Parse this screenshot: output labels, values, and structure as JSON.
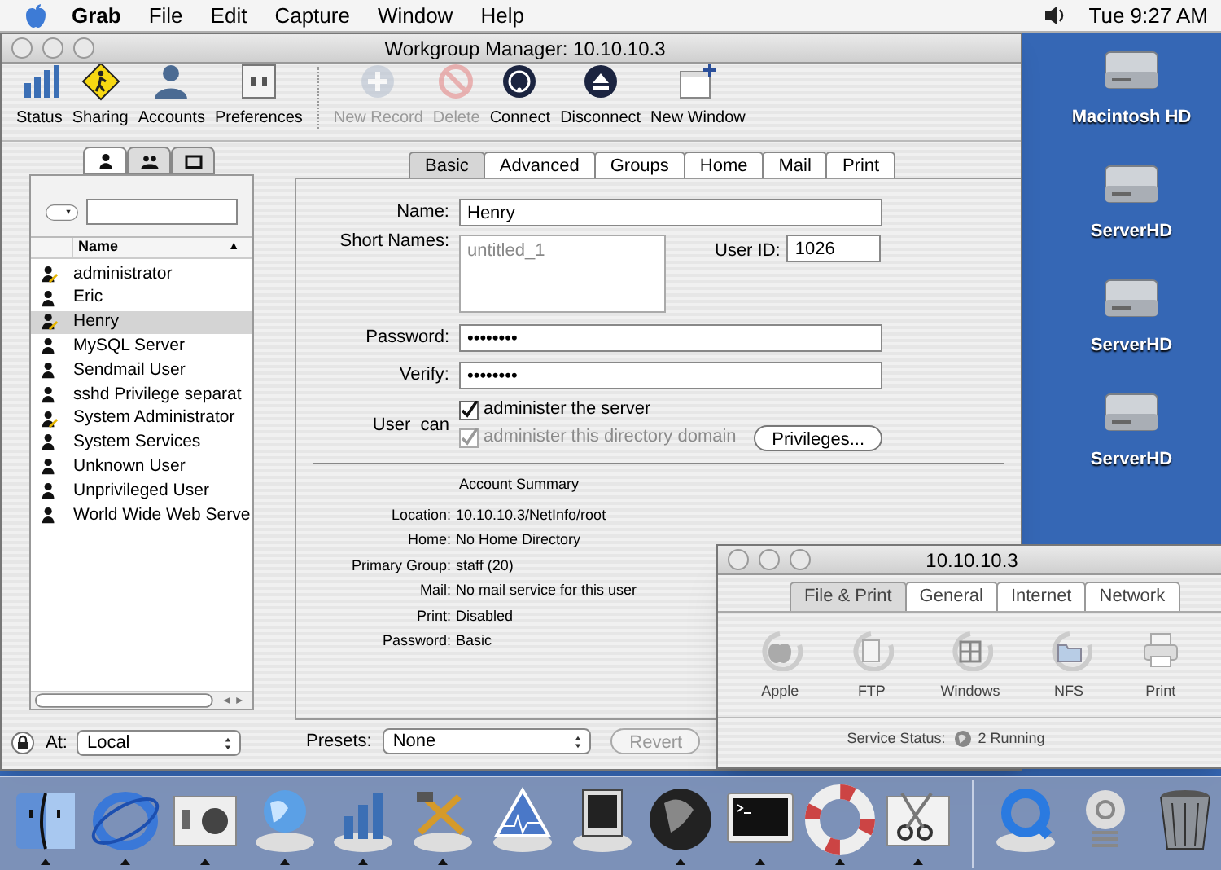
{
  "menu_bar": {
    "app": "Grab",
    "menus": [
      "File",
      "Edit",
      "Capture",
      "Window",
      "Help"
    ],
    "clock": "Tue 9:27 AM"
  },
  "desktop": {
    "volumes": [
      "Macintosh HD",
      "ServerHD",
      "ServerHD",
      "ServerHD"
    ]
  },
  "window": {
    "title": "Workgroup Manager: 10.10.10.3",
    "toolbar_groups": [
      {
        "items": [
          {
            "label": "Status",
            "disabled": false
          },
          {
            "label": "Sharing",
            "disabled": false
          },
          {
            "label": "Accounts",
            "disabled": false
          },
          {
            "label": "Preferences",
            "disabled": false
          }
        ]
      },
      {
        "items": [
          {
            "label": "New Record",
            "disabled": true
          },
          {
            "label": "Delete",
            "disabled": true
          },
          {
            "label": "Connect",
            "disabled": false
          },
          {
            "label": "Disconnect",
            "disabled": false
          },
          {
            "label": "New Window",
            "disabled": false
          }
        ]
      }
    ],
    "record_tabs": [
      {
        "selected": true
      },
      {
        "selected": false
      },
      {
        "selected": false
      }
    ],
    "list_header": "Name",
    "sort_indicator": "▲",
    "users": [
      {
        "name": "administrator",
        "admin": true,
        "selected": false
      },
      {
        "name": "Eric",
        "admin": false,
        "selected": false
      },
      {
        "name": "Henry",
        "admin": true,
        "selected": true
      },
      {
        "name": "MySQL Server",
        "admin": false,
        "selected": false
      },
      {
        "name": "Sendmail User",
        "admin": false,
        "selected": false
      },
      {
        "name": "sshd Privilege separat",
        "admin": false,
        "selected": false
      },
      {
        "name": "System Administrator",
        "admin": true,
        "selected": false
      },
      {
        "name": "System Services",
        "admin": false,
        "selected": false
      },
      {
        "name": "Unknown User",
        "admin": false,
        "selected": false
      },
      {
        "name": "Unprivileged User",
        "admin": false,
        "selected": false
      },
      {
        "name": "World Wide Web Serve",
        "admin": false,
        "selected": false
      }
    ],
    "at_label": "At:",
    "at_value": "Local",
    "tabs": [
      {
        "label": "Basic",
        "selected": true
      },
      {
        "label": "Advanced",
        "selected": false
      },
      {
        "label": "Groups",
        "selected": false
      },
      {
        "label": "Home",
        "selected": false
      },
      {
        "label": "Mail",
        "selected": false
      },
      {
        "label": "Print",
        "selected": false
      }
    ],
    "form": {
      "name_label": "Name:",
      "name": "Henry",
      "short_names_label": "Short Names:",
      "short_names_placeholder": "untitled_1",
      "user_id_label": "User ID:",
      "user_id": "1026",
      "password_label": "Password:",
      "password": "••••••••",
      "verify_label": "Verify:",
      "verify": "••••••••",
      "user_can_label": "User  can",
      "permissions": [
        {
          "label": "administer the server",
          "checked": true,
          "disabled": false
        },
        {
          "label": "administer this directory domain",
          "checked": true,
          "disabled": true
        }
      ],
      "privileges_button": "Privileges..."
    },
    "summary": {
      "title": "Account Summary",
      "rows": [
        {
          "label": "Location:",
          "value": "10.10.10.3/NetInfo/root"
        },
        {
          "label": "Home:",
          "value": "No Home Directory"
        },
        {
          "label": "Primary Group:",
          "value": "staff (20)"
        },
        {
          "label": "Mail:",
          "value": "No mail service for this user"
        },
        {
          "label": "Print:",
          "value": "Disabled"
        },
        {
          "label": "Password:",
          "value": "Basic"
        }
      ]
    },
    "presets_label": "Presets:",
    "presets_value": "None",
    "revert_button": {
      "label": "Revert",
      "disabled": true
    }
  },
  "server_window": {
    "title": "10.10.10.3",
    "tabs": [
      {
        "label": "File & Print",
        "selected": true
      },
      {
        "label": "General",
        "selected": false
      },
      {
        "label": "Internet",
        "selected": false
      },
      {
        "label": "Network",
        "selected": false
      }
    ],
    "services": [
      "Apple",
      "FTP",
      "Windows",
      "NFS",
      "Print"
    ],
    "status_label": "Service Status:",
    "status_value": "2 Running"
  },
  "dock": [
    {
      "running": true
    },
    {
      "running": true
    },
    {
      "running": true
    },
    {
      "running": true
    },
    {
      "running": true
    },
    {
      "running": true
    },
    {
      "running": false
    },
    {
      "running": false
    },
    {
      "running": true
    },
    {
      "running": true
    },
    {
      "running": true
    },
    {
      "running": true
    },
    {
      "running": false
    },
    {
      "running": false
    },
    {
      "running": false
    }
  ]
}
